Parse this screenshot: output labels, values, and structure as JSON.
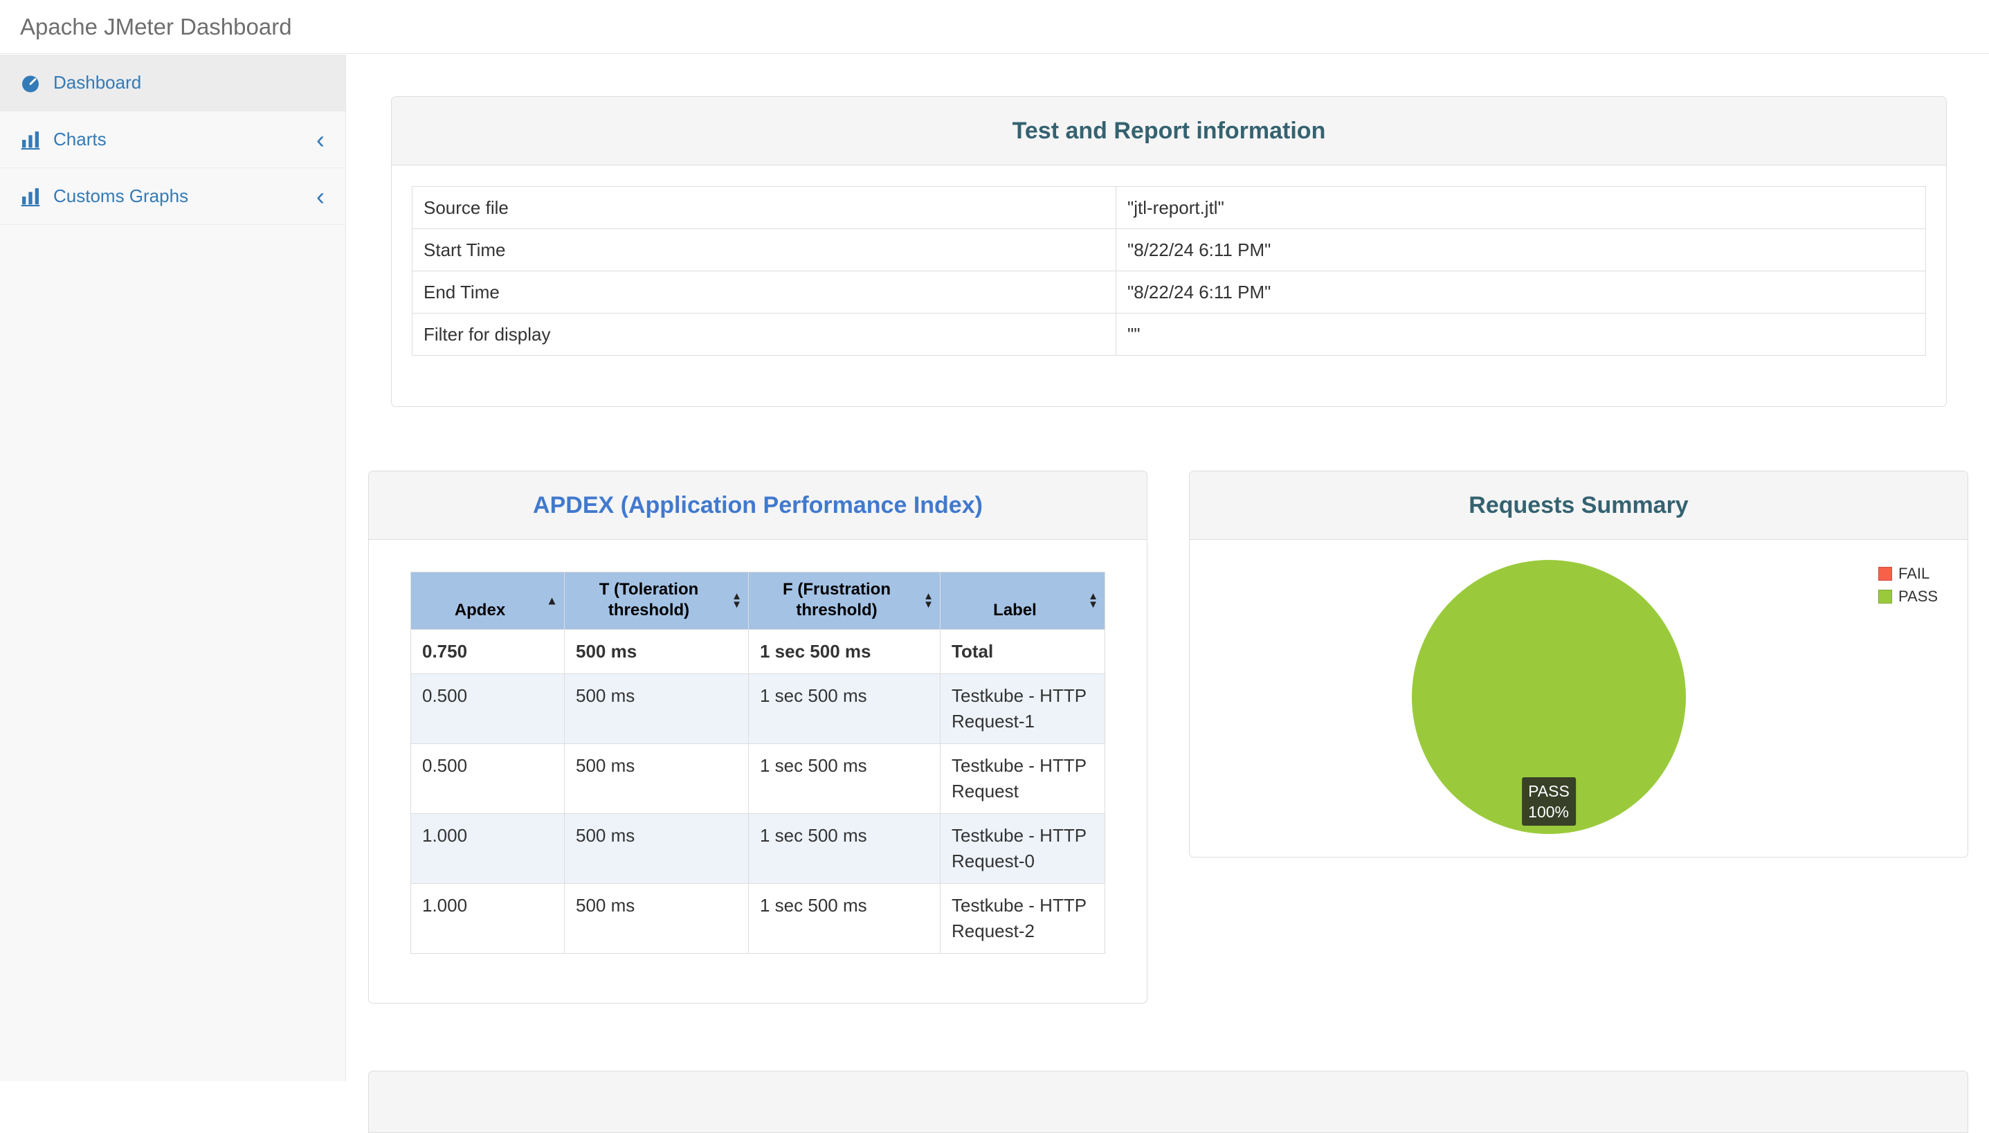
{
  "app": {
    "title": "Apache JMeter Dashboard"
  },
  "colors": {
    "accent": "#337ab7",
    "pass_green": "#9aca3c",
    "fail_red": "#f8604a",
    "panel_title_teal": "#356270",
    "panel_title_blue": "#4179cd",
    "table_header_blue": "#a4c2e4"
  },
  "icons": {
    "sort_asc": "▲",
    "sort_desc": "▼",
    "chevron_collapse": "‹"
  },
  "sidebar": {
    "items": [
      {
        "label": "Dashboard",
        "icon": "dashboard-icon",
        "active": true
      },
      {
        "label": "Charts",
        "icon": "bar-chart-icon",
        "active": false
      },
      {
        "label": "Customs Graphs",
        "icon": "bar-chart-icon",
        "active": false
      }
    ]
  },
  "test_info": {
    "title": "Test and Report information",
    "rows": [
      {
        "label": "Source file",
        "value": "\"jtl-report.jtl\""
      },
      {
        "label": "Start Time",
        "value": "\"8/22/24 6:11 PM\""
      },
      {
        "label": "End Time",
        "value": "\"8/22/24 6:11 PM\""
      },
      {
        "label": "Filter for display",
        "value": "\"\""
      }
    ]
  },
  "apdex": {
    "title": "APDEX (Application Performance Index)",
    "columns": [
      "Apdex",
      "T (Toleration threshold)",
      "F (Frustration threshold)",
      "Label"
    ],
    "sorted_column": "Apdex",
    "sort_direction": "asc",
    "rows": [
      [
        "0.750",
        "500 ms",
        "1 sec 500 ms",
        "Total"
      ],
      [
        "0.500",
        "500 ms",
        "1 sec 500 ms",
        "Testkube - HTTP Request-1"
      ],
      [
        "0.500",
        "500 ms",
        "1 sec 500 ms",
        "Testkube - HTTP Request"
      ],
      [
        "1.000",
        "500 ms",
        "1 sec 500 ms",
        "Testkube - HTTP Request-0"
      ],
      [
        "1.000",
        "500 ms",
        "1 sec 500 ms",
        "Testkube - HTTP Request-2"
      ]
    ]
  },
  "requests_summary": {
    "title": "Requests Summary",
    "legend": [
      {
        "label": "FAIL",
        "color": "#f8604a"
      },
      {
        "label": "PASS",
        "color": "#9aca3c"
      }
    ],
    "tooltip_label": "PASS",
    "tooltip_value": "100%"
  },
  "chart_data": {
    "type": "pie",
    "title": "Requests Summary",
    "labels": [
      "FAIL",
      "PASS"
    ],
    "values": [
      0,
      100
    ],
    "colors": {
      "fail": "#f8604a",
      "pass": "#9aca3c"
    },
    "annotation": "PASS 100%",
    "legend_position": "top-right"
  }
}
